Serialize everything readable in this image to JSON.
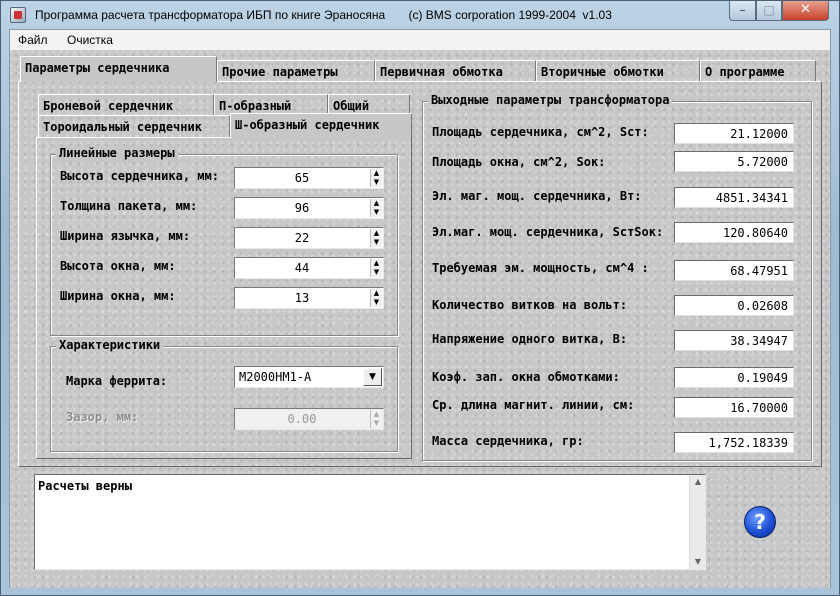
{
  "window": {
    "title": "Программа расчета трансформатора ИБП по книге Эраносяна       (c) BMS corporation 1999-2004  v1.03",
    "controls": {
      "minimize": "–",
      "maximize": "□",
      "close": "✕"
    }
  },
  "menu": {
    "file": "Файл",
    "clear": "Очистка"
  },
  "main_tabs": [
    "Параметры сердечника",
    "Прочие параметры",
    "Первичная обмотка",
    "Вторичные обмотки",
    "О программе"
  ],
  "core_tabs": {
    "row1": [
      "Броневой сердечник",
      "П-образный",
      "Общий"
    ],
    "row2": [
      "Тороидальный сердечник",
      "Ш-образный сердечник"
    ]
  },
  "linear": {
    "title": "Линейные размеры",
    "fields": [
      {
        "label": "Высота сердечника, мм:",
        "value": "65"
      },
      {
        "label": "Толщина пакета, мм:",
        "value": "96"
      },
      {
        "label": "Ширина язычка, мм:",
        "value": "22"
      },
      {
        "label": "Высота окна, мм:",
        "value": "44"
      },
      {
        "label": "Ширина окна, мм:",
        "value": "13"
      }
    ]
  },
  "characteristics": {
    "title": "Характеристики",
    "ferrite_label": "Марка феррита:",
    "ferrite_value": "М2000НМ1-А",
    "gap_label": "Зазор, мм:",
    "gap_value": "0.00"
  },
  "output": {
    "title": "Выходные параметры трансформатора",
    "rows": [
      {
        "label": "Площадь сердечника, см^2, Sст:",
        "value": "21.12000"
      },
      {
        "label": "Площадь окна, см^2, Sок:",
        "value": "5.72000"
      },
      {
        "label": "Эл. маг. мощ. сердечника, Вт:",
        "value": "4851.34341"
      },
      {
        "label": "Эл.маг. мощ. сердечника, SстSок:",
        "value": "120.80640"
      },
      {
        "label": "Требуемая эм. мощность, см^4 :",
        "value": "68.47951"
      },
      {
        "label": "Количество витков на вольт:",
        "value": "0.02608"
      },
      {
        "label": "Напряжение одного витка, В:",
        "value": "38.34947"
      },
      {
        "label": "Коэф. зап. окна обмотками:",
        "value": "0.19049"
      },
      {
        "label": "Ср. длина магнит. линии, см:",
        "value": "16.70000"
      },
      {
        "label": "Масса сердечника, гр:",
        "value": "1,752.18339"
      }
    ]
  },
  "status_text": "Расчеты верны",
  "help_label": "?"
}
